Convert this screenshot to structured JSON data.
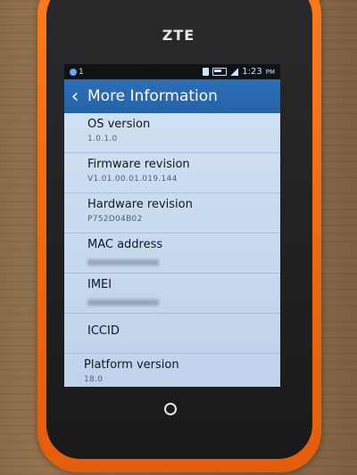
{
  "device": {
    "brand": "ZTE"
  },
  "status_bar": {
    "notification_count": "1",
    "time": "1:23",
    "ampm": "PM"
  },
  "header": {
    "back_icon": "‹",
    "title": "More Information"
  },
  "items": [
    {
      "label": "OS version",
      "value": "1.0.1.0",
      "redacted": false
    },
    {
      "label": "Firmware revision",
      "value": "V1.01.00.01.019.144",
      "redacted": false
    },
    {
      "label": "Hardware revision",
      "value": "P752D04B02",
      "redacted": false
    },
    {
      "label": "MAC address",
      "value": "",
      "redacted": true
    },
    {
      "label": "IMEI",
      "value": "",
      "redacted": true
    },
    {
      "label": "ICCID",
      "value": "",
      "redacted": false
    },
    {
      "label": "Platform version",
      "value": "18.0",
      "redacted": false
    }
  ],
  "colors": {
    "header_bg": "#2563a8",
    "list_bg": "#cfe0f2",
    "phone_body": "#f06a12"
  }
}
